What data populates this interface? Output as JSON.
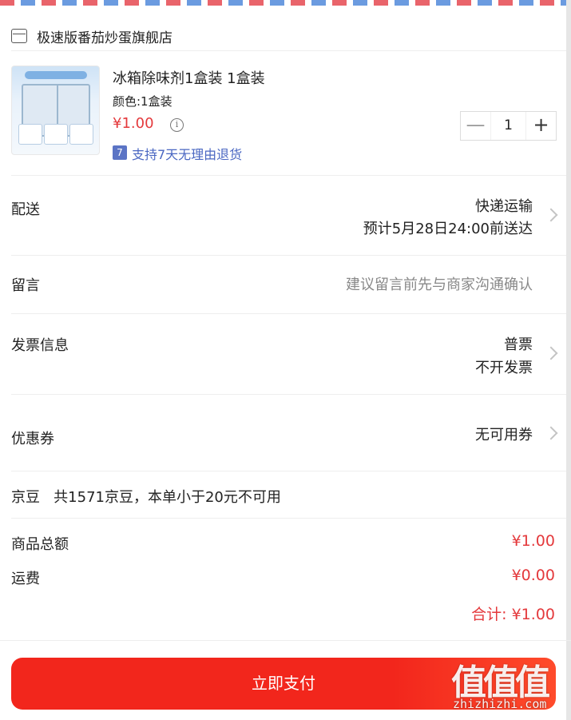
{
  "shop": {
    "icon": "store-icon",
    "name": "极速版番茄炒蛋旗舰店"
  },
  "product": {
    "image_icon": "fridge-deodorizer-image",
    "title": "冰箱除味剂1盒装 1盒装",
    "spec": "颜色:1盒装",
    "price": "¥1.00",
    "info_icon": "info-icon",
    "return_badge": "7",
    "return_text": "支持7天无理由退货",
    "quantity": "1",
    "minus": "—",
    "plus": "+"
  },
  "delivery": {
    "label": "配送",
    "method": "快递运输",
    "eta": "预计5月28日24:00前送达"
  },
  "message": {
    "label": "留言",
    "placeholder": "建议留言前先与商家沟通确认"
  },
  "invoice": {
    "label": "发票信息",
    "type": "普票",
    "status": "不开发票"
  },
  "coupon": {
    "label": "优惠券",
    "value": "无可用券"
  },
  "jingdou": {
    "text": "京豆   共1571京豆，本单小于20元不可用"
  },
  "summary": {
    "goods_label": "商品总额",
    "goods_value": "¥1.00",
    "shipping_label": "运费",
    "shipping_value": "¥0.00",
    "total": "合计: ¥1.00"
  },
  "pay_button": "立即支付",
  "watermark": {
    "logo": "值值值",
    "url": "zhizhizhi.com"
  },
  "colors": {
    "price_red": "#e4393c",
    "pay_button": "#f2261c",
    "link_blue": "#4a67c2"
  }
}
